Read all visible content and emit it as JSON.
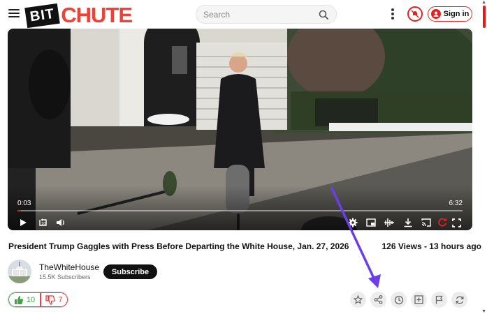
{
  "header": {
    "logo_bit": "BIT",
    "logo_chute": "CHUTE",
    "search_placeholder": "Search",
    "signin_label": "Sign in"
  },
  "player": {
    "current_time": "0:03",
    "duration": "6:32",
    "progress_fraction": 0.008
  },
  "video": {
    "title": "President Trump Gaggles with Press Before Departing the White House, Jan. 27, 2026",
    "stats": "126 Views - 13 hours ago"
  },
  "channel": {
    "name": "TheWhiteHouse",
    "subscribers": "15.5K Subscribers",
    "subscribe_label": "Subscribe"
  },
  "votes": {
    "likes": "10",
    "dislikes": "7"
  },
  "colors": {
    "brand_red": "#e52222",
    "like_green": "#3fa63f",
    "annotation_arrow": "#6a3ee8"
  },
  "icons": [
    "menu-icon",
    "search-icon",
    "more-vert-icon",
    "notifications-off-icon",
    "user-icon",
    "play-icon",
    "replay-10-icon",
    "volume-icon",
    "settings-icon",
    "picture-in-picture-icon",
    "audio-levels-icon",
    "download-icon",
    "cast-icon",
    "loop-icon",
    "fullscreen-icon",
    "thumbs-up-icon",
    "thumbs-down-icon",
    "favorite-star-icon",
    "share-icon",
    "watch-later-icon",
    "add-to-playlist-icon",
    "flag-icon",
    "refresh-icon"
  ]
}
